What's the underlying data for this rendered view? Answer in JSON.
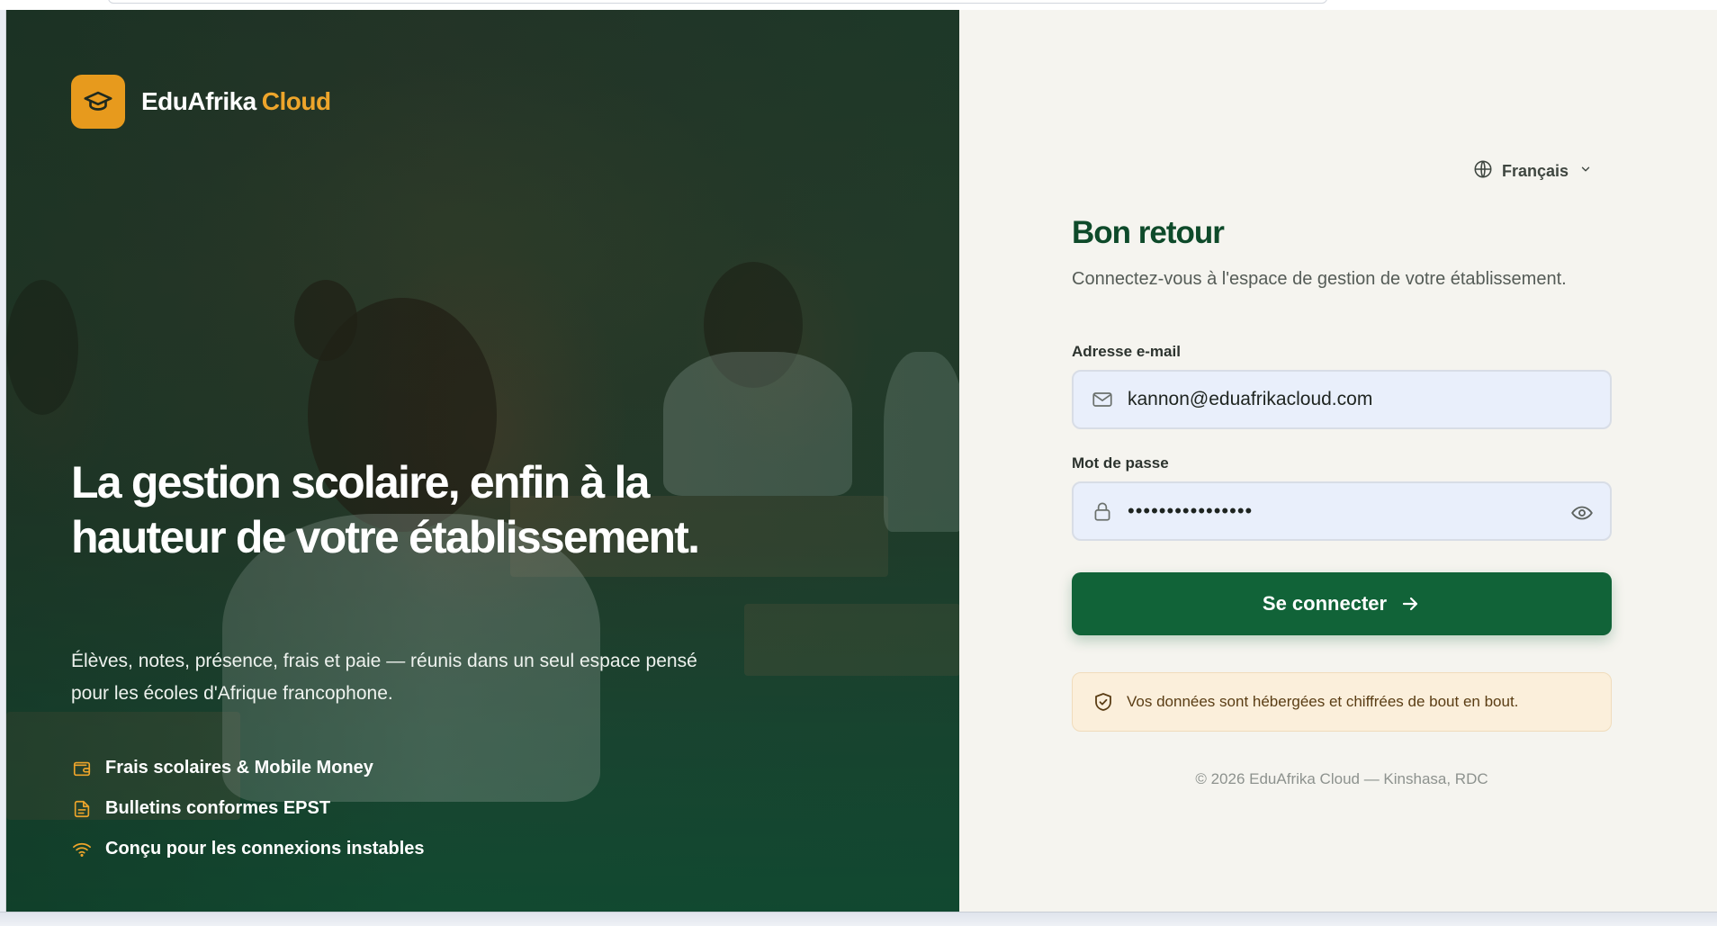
{
  "brand": {
    "name": "EduAfrika",
    "accent": "Cloud",
    "icon": "graduation-cap-icon"
  },
  "hero": {
    "headline": "La gestion scolaire, enfin à la hauteur de votre établissement.",
    "subline": "Élèves, notes, présence, frais et paie — réunis dans un seul espace pensé pour les écoles d'Afrique francophone.",
    "features": [
      {
        "icon": "wallet-icon",
        "label": "Frais scolaires & Mobile Money"
      },
      {
        "icon": "document-icon",
        "label": "Bulletins conformes EPST"
      },
      {
        "icon": "wifi-icon",
        "label": "Conçu pour les connexions instables"
      }
    ]
  },
  "language": {
    "label": "Français",
    "icon": "globe-icon"
  },
  "login": {
    "title": "Bon retour",
    "subtitle": "Connectez-vous à l'espace de gestion de votre établissement.",
    "email_label": "Adresse e-mail",
    "email_value": "kannon@eduafrikacloud.com",
    "password_label": "Mot de passe",
    "password_value": "••••••••••••••••",
    "submit_label": "Se connecter",
    "notice": "Vos données sont hébergées et chiffrées de bout en bout.",
    "footer": "© 2026 EduAfrika Cloud — Kinshasa, RDC"
  },
  "colors": {
    "primary": "#116338",
    "accent": "#e79a1d",
    "title": "#0e4a2a",
    "notice_bg": "#fbefdb"
  }
}
